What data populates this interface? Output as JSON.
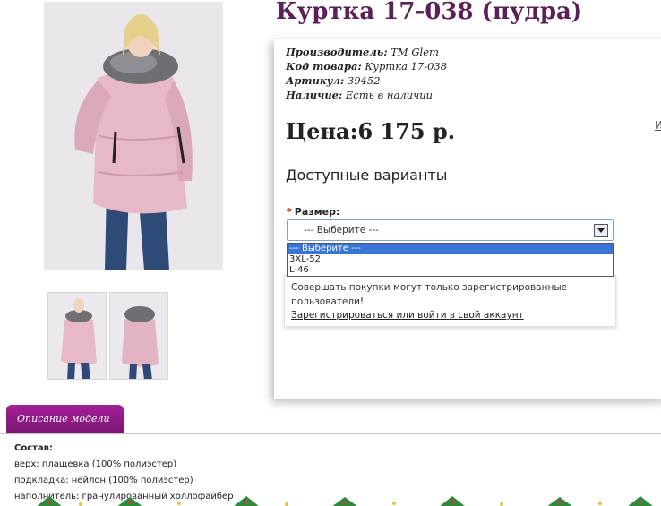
{
  "product": {
    "title": "Куртка 17-038 (пудра)"
  },
  "meta": {
    "manufacturer_label": "Производитель:",
    "manufacturer_value": "TM Glem",
    "code_label": "Код товара:",
    "code_value": "Куртка 17-038",
    "article_label": "Артикул:",
    "article_value": "39452",
    "stock_label": "Наличие:",
    "stock_value": "Есть в наличии"
  },
  "price": {
    "text": "Цена:6 175 р."
  },
  "side_link": "И",
  "variants": {
    "heading": "Доступные варианты",
    "required_mark": "*",
    "size_label": "Размер:",
    "selected": "--- Выберите ---",
    "options": [
      "--- Выберите ---",
      "3XL-52",
      "L-46"
    ]
  },
  "notice": {
    "message": "Совершать покупки могут только зарегистрированные пользователи!",
    "link": "Зарегистрироваться или войти в свой аккаунт"
  },
  "tab": {
    "label": "Описание модели"
  },
  "description": {
    "heading": "Состав:",
    "lines": [
      "верх: плащевка (100% полиэстер)",
      "подкладка: нейлон (100% полиэстер)",
      "наполнитель: гранулированный холлофайбер"
    ]
  },
  "colors": {
    "title": "#5c1f5a",
    "tab": "#9b1d8f",
    "jacket": "#e7b9c6",
    "jeans": "#2e4b78",
    "fur": "#6e6e74",
    "highlight": "#3875d7"
  }
}
